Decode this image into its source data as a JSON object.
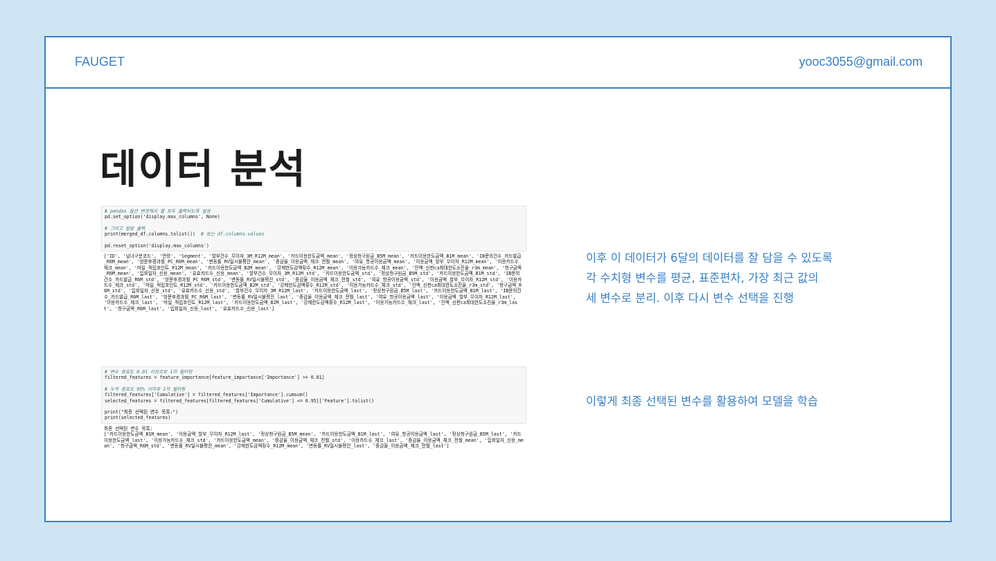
{
  "header": {
    "brand": "FAUGET",
    "email": "yooc3055@gmail.com"
  },
  "title": "데이터 분석",
  "code_block_1": {
    "comment_1": "# pandas 옵션 변경해서 열 모두 출력되도록 설정",
    "line_1": "pd.set_option('display.max_columns', None)",
    "comment_2": "# 그리고 칼럼 출력",
    "line_2": "print(merged_df.columns.tolist())",
    "comment_2b": "# 또는 df.columns.values",
    "line_3": "pd.reset_option('display.max_columns')",
    "output": "['ID', '남녀구분코드', '연령', 'Segment', '할부건수_무이자_3M_R12M_mean', '카드이용한도금액_mean', '정상청구원금_B5M_mean', '카드이용한도금액_B1M_mean', 'IB문의건수_카드발급_R6M_mean', '방문후경과월_PC_R6M_mean', '변동률_RV일시불평잔_mean', '증감율_이용금액_체크_전월_mean', '여유_항공이용금액_mean', '이용금액_할부_무이자_R12M_mean', '이용카드수_체크_mean', '마일_적립포인트_R12M_mean', '카드이용한도금액_B2M_mean', '강제한도감액횟수_R12M_mean', '이용가능카드수_체크_mean', '잔액_신판ca최대한도소진율_r3m_mean', '청구금액_R6M_mean', '입회일자_신용_mean', '유효카드수_신용_mean', '할부건수_무이자_3M_R12M_std', '카드이용한도금액_std', '정상청구원금_B5M_std', '카드이용한도금액_B1M_std', 'IB문의건수_카드발급_R6M_std', '방문후경과월_PC_R6M_std', '변동률_RV일시불평잔_std', '증감율_이용금액_체크_전월_std', '여유_항공이용금액_std', '이용금액_할부_무이자_R12M_std', '이용카드수_체크_std', '마일_적립포인트_R12M_std', '카드이용한도금액_B2M_std', '강제한도감액횟수_R12M_std', '이용가능카드수_체크_std', '잔액_신판ca최대한도소진율_r3m_std', '청구금액_R6M_std', '입회일자_신용_std', '유효카드수_신용_std', '할부건수_무이자_3M_R12M_last', '카드이용한도금액_last', '정상청구원금_B5M_last', '카드이용한도금액_B1M_last', 'IB문의건수_카드발급_R6M_last', '방문후경과월_PC_R6M_last', '변동률_RV일시불평잔_last', '증감율_이용금액_체크_전월_last', '여유_항공이용금액_last', '이용금액_할부_무이자_R12M_last', '이용카드수_체크_last', '마일_적립포인트_R12M_last', '카드이용한도금액_B2M_last', '강제한도감액횟수_R12M_last', '이용가능카드수_체크_last', '잔액_신판ca최대한도소진율_r3m_last', '청구금액_R6M_last', '입회일자_신용_last', '유효카드수_신용_last']"
  },
  "code_block_2": {
    "comment_1": "# 변수 중요도 0.01 이상으로 1차 필터링",
    "line_1": "filtered_features = feature_importance[feature_importance['Importance'] >= 0.01]",
    "comment_2": "# 누적 중요도 95% 이하로 2차 필터링",
    "line_2": "filtered_features['Cumulative'] = filtered_features['Importance'].cumsum()",
    "line_3": "selected_features = filtered_features[filtered_features['Cumulative'] <= 0.95]['Feature'].tolist()",
    "line_4": "print(\"최종 선택된 변수 목록:\")",
    "line_5": "print(selected_features)",
    "output_label": "최종 선택된 변수 목록:",
    "output": "['카드이용한도금액_B1M_mean', '이용금액_할부_무이자_R12M_last', '정상청구원금_B5M_mean', '카드이용한도금액_B1M_last', '여유_항공이용금액_last', '정상청구원금_B5M_last', '카드이용한도금액_last', '이용가능카드수_체크_std', '카드이용한도금액_mean', '증감율_이용금액_체크_전월_std', '이용카드수_체크_last', '증감율_이용금액_체크_전월_mean', '입회일자_신용_mean', '청구금액_R6M_std', '변동률_RV일시불평잔_mean', '강제한도감액횟수_R12M_mean', '변동률_RV일시불평잔_last', '증감율_이용금액_체크_전월_last']"
  },
  "description_1": {
    "line_1": "이후 이 데이터가 6달의 데이터를 잘 담을 수 있도록",
    "line_2": "각 수치형 변수를 평균, 표준편차, 가장 최근 값의",
    "line_3": "세 변수로 분리. 이후 다시 변수 선택을 진행"
  },
  "description_2": "이렇게 최종 선택된 변수를 활용하여 모델을 학습"
}
